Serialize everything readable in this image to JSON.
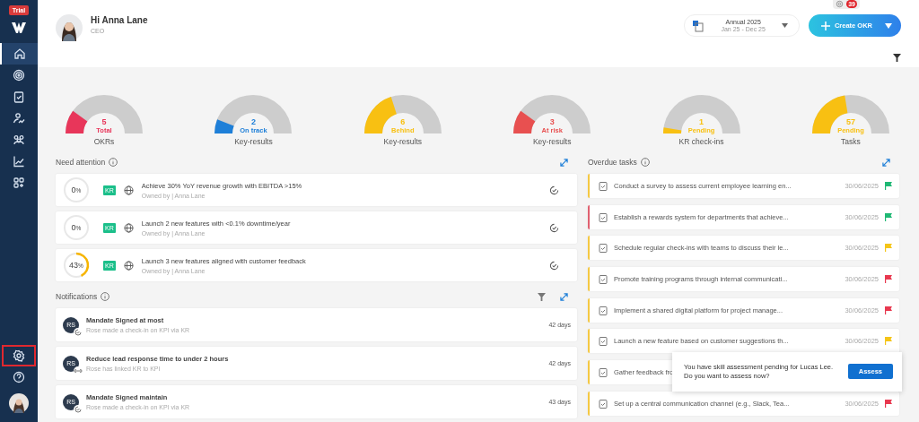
{
  "sidebar": {
    "badge": "Trial",
    "items": [
      {
        "selected": true,
        "highlighted": false
      },
      {
        "selected": false,
        "highlighted": false
      },
      {
        "selected": false,
        "highlighted": false
      },
      {
        "selected": false,
        "highlighted": false
      },
      {
        "selected": false,
        "highlighted": false
      },
      {
        "selected": false,
        "highlighted": false
      },
      {
        "selected": false,
        "highlighted": false
      }
    ],
    "bottom_items": [
      {
        "selected": false,
        "highlighted": true
      },
      {
        "selected": false,
        "highlighted": false
      }
    ]
  },
  "header": {
    "greeting": "Hi Anna Lane",
    "role": "CEO",
    "notification_count": "39",
    "period": {
      "title": "Annual 2025",
      "range": "Jan 25 - Dec 25"
    },
    "create_button": "Create OKR"
  },
  "gauges": [
    {
      "value": "5",
      "status": "Total",
      "label": "OKRs",
      "color": "#e8365a",
      "level": 0.2
    },
    {
      "value": "2",
      "status": "On track",
      "label": "Key-results",
      "color": "#1e7fd8",
      "level": 0.12
    },
    {
      "value": "6",
      "status": "Behind",
      "label": "Key-results",
      "color": "#f8c012",
      "level": 0.4
    },
    {
      "value": "3",
      "status": "At risk",
      "label": "Key-results",
      "color": "#e85050",
      "level": 0.2
    },
    {
      "value": "1",
      "status": "Pending",
      "label": "KR check-ins",
      "color": "#f8c012",
      "level": 0.05
    },
    {
      "value": "57",
      "status": "Pending",
      "label": "Tasks",
      "color": "#f8c012",
      "level": 0.45
    }
  ],
  "need_attention": {
    "title": "Need attention",
    "items": [
      {
        "percent": "0",
        "unit": "%",
        "level": 0,
        "badge": "KR",
        "title": "Achieve 30% YoY revenue growth with EBITDA >15%",
        "owner": "Owned by | Anna Lane"
      },
      {
        "percent": "0",
        "unit": "%",
        "level": 0,
        "badge": "KR",
        "title": "Launch 2 new features with <0.1% downtime/year",
        "owner": "Owned by | Anna Lane"
      },
      {
        "percent": "43",
        "unit": "%",
        "level": 0.43,
        "badge": "KR",
        "title": "Launch 3 new features aligned with customer feedback",
        "owner": "Owned by | Anna Lane"
      }
    ]
  },
  "notifications": {
    "title": "Notifications",
    "items": [
      {
        "initials": "RS",
        "kind": "checkin",
        "title": "Mandate Signed at most",
        "text": "Rose made a check-in on KPI via KR",
        "age": "42 days"
      },
      {
        "initials": "RS",
        "kind": "link",
        "title": "Reduce lead response time to under 2 hours",
        "text": "Rose has linked KR to KPI",
        "age": "42 days"
      },
      {
        "initials": "RS",
        "kind": "checkin",
        "title": "Mandate Signed maintain",
        "text": "Rose made a check-in on KPI via KR",
        "age": "43 days"
      }
    ]
  },
  "overdue_tasks": {
    "title": "Overdue tasks",
    "items": [
      {
        "title": "Conduct a survey to assess current employee learning en...",
        "date": "30/06/2025",
        "at_risk": false,
        "color": "#1fb874"
      },
      {
        "title": "Establish a rewards system for departments that achieve...",
        "date": "30/06/2025",
        "at_risk": true,
        "color": "#1fb874"
      },
      {
        "title": "Schedule regular check-ins with teams to discuss their le...",
        "date": "30/06/2025",
        "at_risk": false,
        "color": "#f5c518"
      },
      {
        "title": "Promote training programs through internal communicati...",
        "date": "30/06/2025",
        "at_risk": false,
        "color": "#e8384f"
      },
      {
        "title": "Implement a shared digital platform for project manage...",
        "date": "30/06/2025",
        "at_risk": false,
        "color": "#e8384f"
      },
      {
        "title": "Launch a new feature based on customer suggestions th...",
        "date": "30/06/2025",
        "at_risk": false,
        "color": "#f5c518"
      },
      {
        "title": "Gather feedback fro",
        "at_risk": false
      },
      {
        "title": "Set up a central communication channel (e.g., Slack, Tea...",
        "date": "30/06/2025",
        "at_risk": false,
        "color": "#e8384f"
      }
    ]
  },
  "toast": {
    "message": "You have skill assessment pending for Lucas Lee. Do you want to assess now?",
    "button": "Assess"
  }
}
